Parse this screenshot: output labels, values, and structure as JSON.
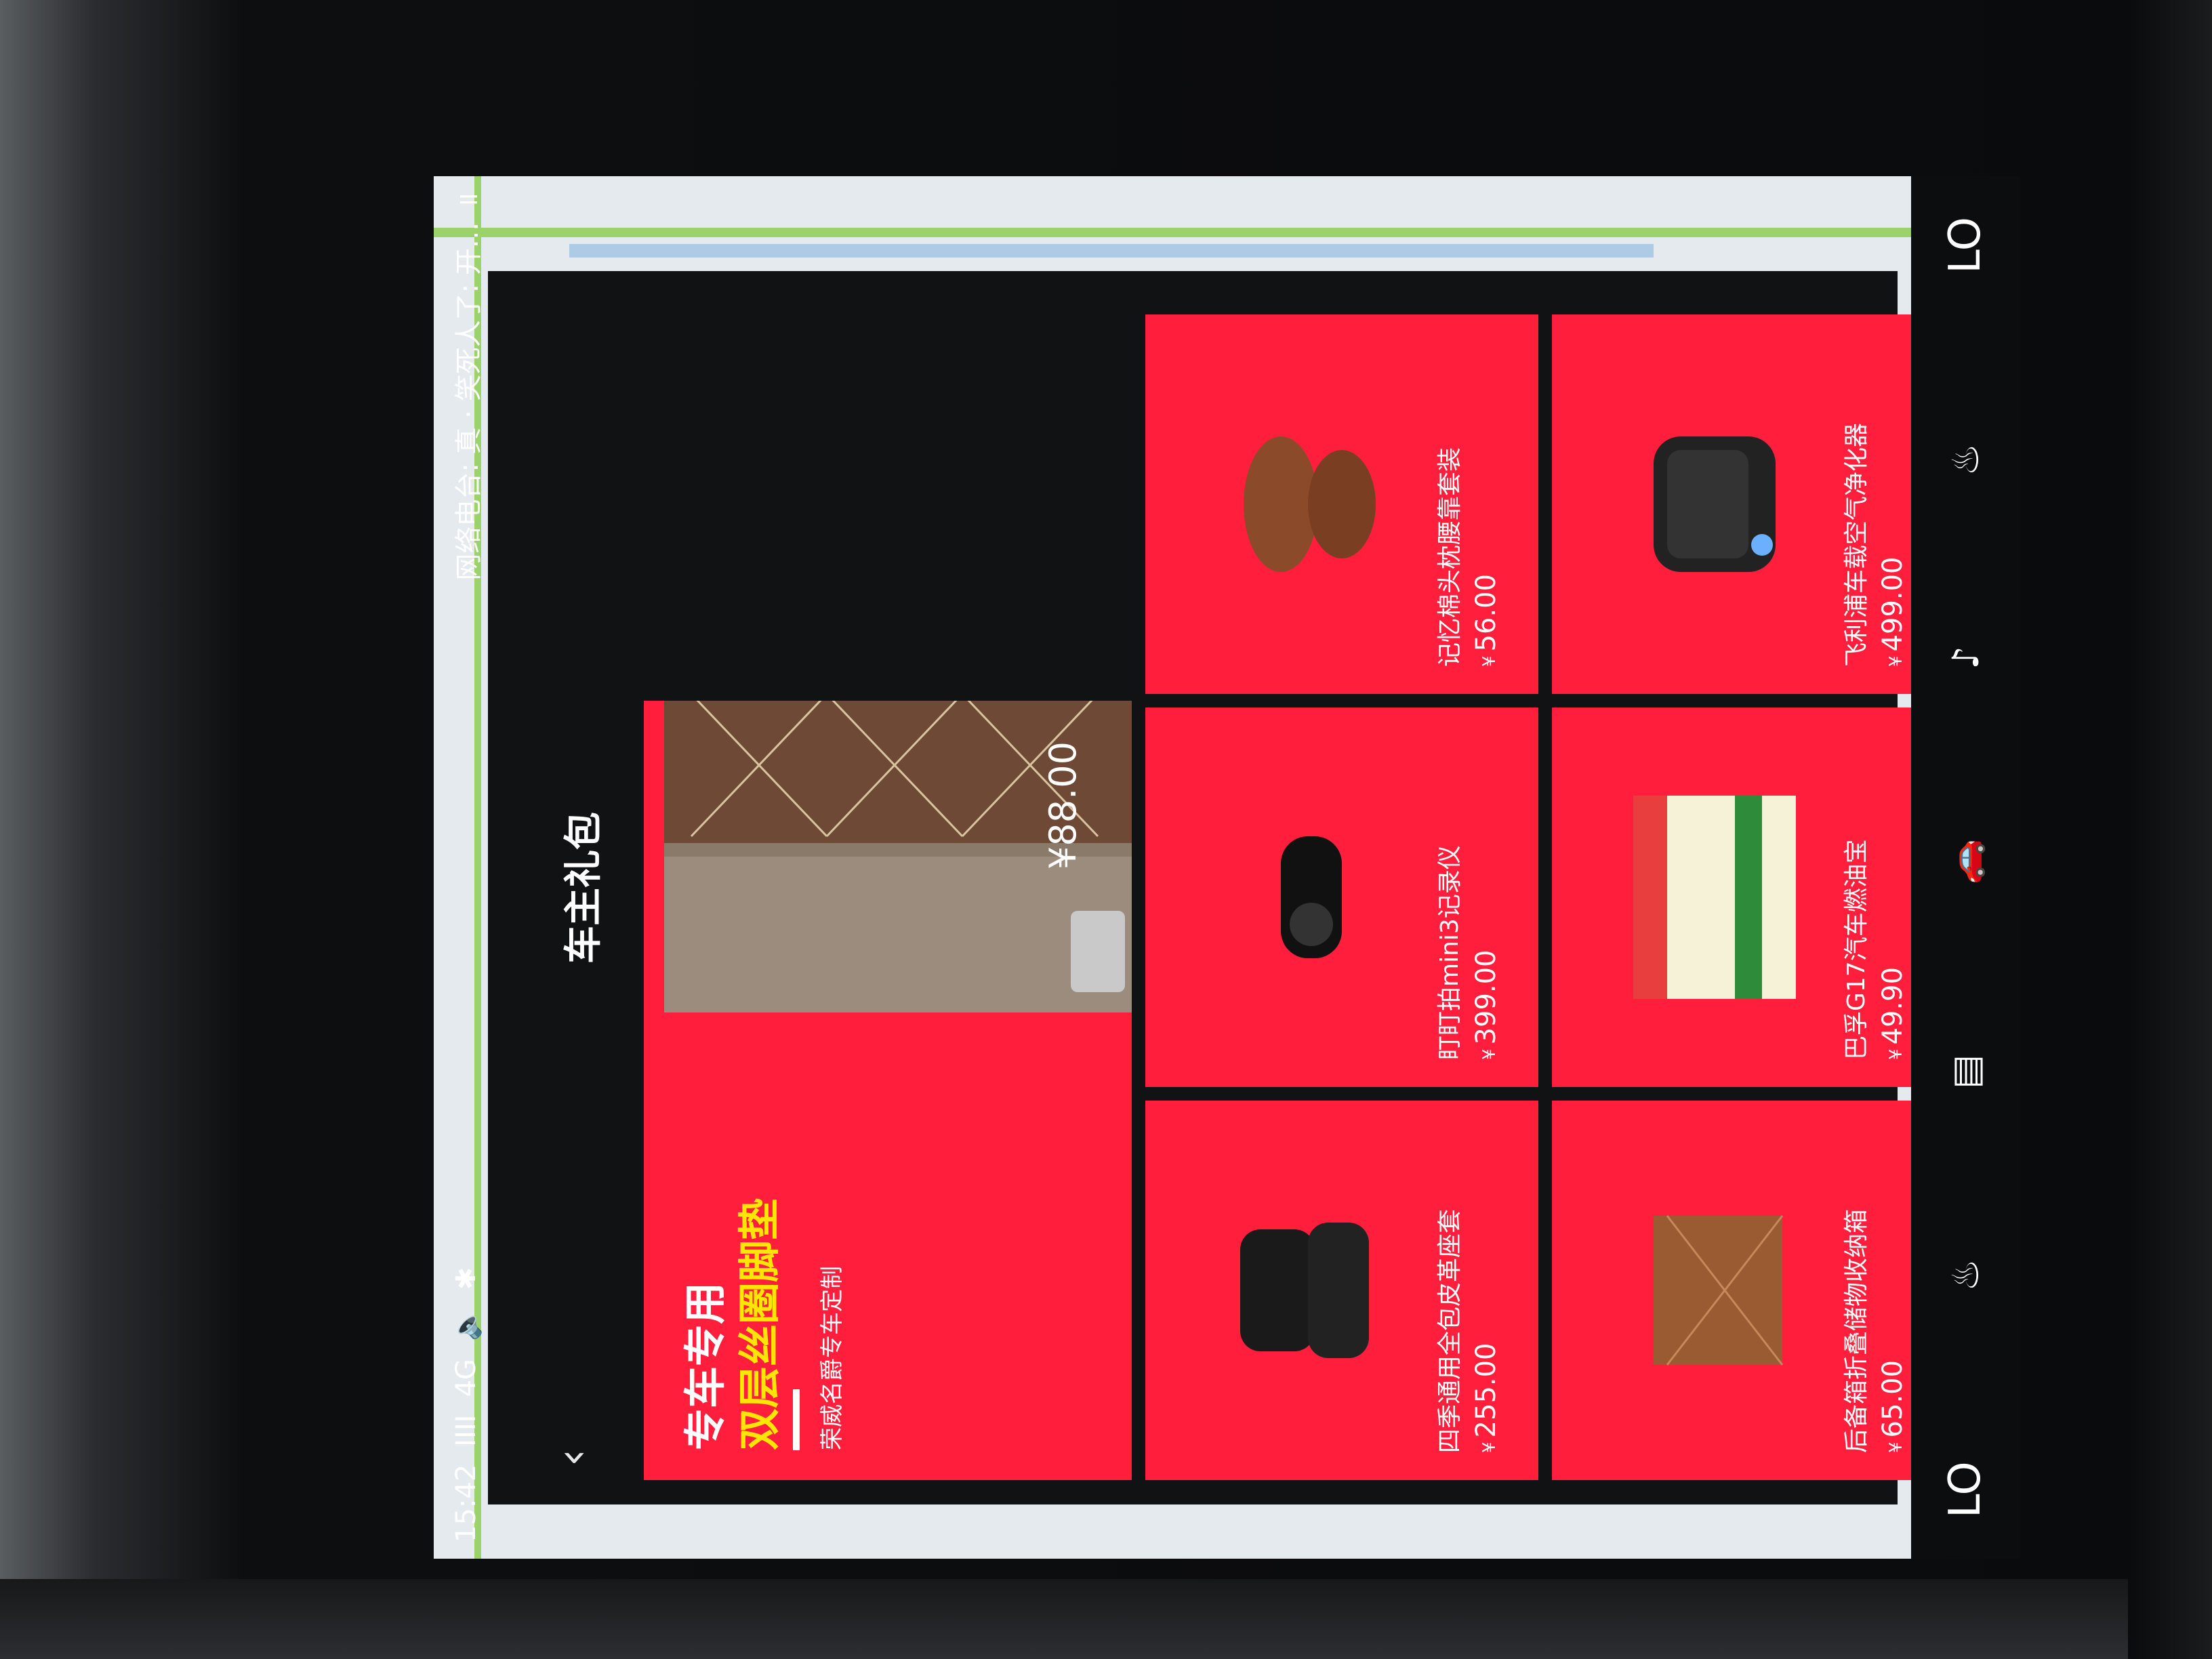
{
  "status_bar": {
    "time": "15:42",
    "signal": "IIII",
    "network": "4G",
    "volume_icon": "volume-icon",
    "bluetooth_icon": "bluetooth-icon",
    "now_playing": "网络电台: 真 · 笑死人了: 开...",
    "pause_icon": "pause-icon"
  },
  "panel": {
    "title": "车主礼包",
    "back_icon": "chevron-left-icon"
  },
  "hero": {
    "headline1": "专车专用",
    "headline2": "双层丝圈脚垫",
    "subtitle": "荣威名爵专车定制",
    "currency": "¥",
    "price": "88.00"
  },
  "products": [
    {
      "name": "四季通用全包皮革座套",
      "currency": "¥",
      "price": "255.00",
      "icon": "seat-cover-image"
    },
    {
      "name": "后备箱折叠储物收纳箱",
      "currency": "¥",
      "price": "65.00",
      "icon": "storage-box-image"
    },
    {
      "name": "盯盯拍mini3记录仪",
      "currency": "¥",
      "price": "399.00",
      "icon": "dashcam-image"
    },
    {
      "name": "巴孚G17汽车燃油宝",
      "currency": "¥",
      "price": "49.90",
      "icon": "fuel-additive-image"
    },
    {
      "name": "记忆棉头枕腰靠套装",
      "currency": "¥",
      "price": "56.00",
      "icon": "pillow-set-image"
    },
    {
      "name": "飞利浦车载空气净化器",
      "currency": "¥",
      "price": "499.00",
      "icon": "air-purifier-image"
    }
  ],
  "dock": {
    "left_temp": "LO",
    "right_temp": "LO",
    "seat_heat_left_icon": "seat-heat-icon",
    "seat_heat_right_icon": "seat-heat-icon",
    "apps_icon": "apps-icon",
    "car_icon": "car-icon",
    "music_icon": "music-icon"
  },
  "colors": {
    "card_red": "#ff1f3c",
    "accent_yellow": "#ffe600",
    "panel_dark": "#111214"
  }
}
